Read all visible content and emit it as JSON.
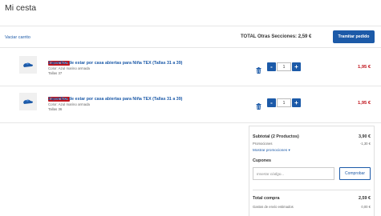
{
  "page": {
    "title": "Mi cesta"
  },
  "toolbar": {
    "empty_cart": "Vaciar carrito",
    "other_sections_label": "TOTAL Otras Secciones:",
    "other_sections_value": "2,59 €",
    "checkout_button": "Tramitar pedido"
  },
  "items": [
    {
      "badge": "2ª Ud al 70%",
      "name": "Zapatillas de estar por casa abiertas para Niña TEX (Tallas 31 a 39)",
      "color": "Color: Azul marino armada",
      "size": "Tallas 37",
      "quantity": "1",
      "price": "1,95 €"
    },
    {
      "badge": "2ª Ud al 70%",
      "name": "Zapatillas de estar por casa abiertas para Niña TEX (Tallas 31 a 39)",
      "color": "Color: Azul marino armada",
      "size": "Tallas 36",
      "quantity": "1",
      "price": "1,95 €"
    }
  ],
  "summary": {
    "subtotal_label": "Subtotal (2 Productos)",
    "subtotal_value": "3,90 €",
    "promotions_label": "Promociones",
    "promotions_value": "-1,30 €",
    "show_promotions": "Mostrar promociones",
    "coupons_label": "Cupones",
    "coupon_placeholder": "Insertar código...",
    "check_button": "Comprobar",
    "total_label": "Total compra",
    "total_value": "2,59 €",
    "shipping_label": "Gastos de envío estimados",
    "shipping_value": "0,00 €"
  },
  "icons": {
    "trash": "trash-icon",
    "minus": "minus-icon",
    "plus": "plus-icon",
    "chevron": "chevron-down-icon"
  },
  "colors": {
    "accent": "#1c5aa8",
    "price": "#c0141c",
    "badge": "#c0141c"
  }
}
